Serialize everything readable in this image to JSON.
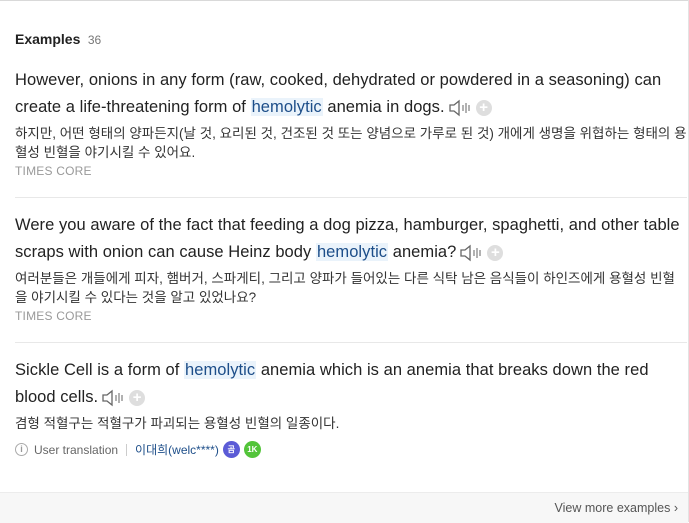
{
  "header": {
    "title": "Examples",
    "count": "36"
  },
  "examples": [
    {
      "en_before": "However, onions in any form (raw, cooked, dehydrated or powdered in a seasoning) can create a life-threatening form of ",
      "en_highlight": "hemolytic",
      "en_after": " anemia in dogs.",
      "ko": "하지만, 어떤 형태의 양파든지(날 것, 요리된 것, 건조된 것 또는 양념으로 가루로 된 것) 개에게 생명을 위협하는 형태의 용혈성 빈혈을 야기시킬 수 있어요.",
      "source": "TIMES CORE"
    },
    {
      "en_before": "Were you aware of the fact that feeding a dog pizza, hamburger, spaghetti, and other table scraps with onion can cause Heinz body ",
      "en_highlight": "hemolytic",
      "en_after": " anemia?",
      "ko": "여러분들은 개들에게 피자, 햄버거, 스파게티, 그리고 양파가 들어있는 다른 식탁 남은 음식들이 하인즈에게 용혈성 빈혈을 야기시킬 수 있다는 것을 알고 있었나요?",
      "source": "TIMES CORE"
    },
    {
      "en_before": "Sickle Cell is a form of ",
      "en_highlight": "hemolytic",
      "en_after": " anemia which is an anemia that breaks down the red blood cells.",
      "ko": "겸형 적혈구는 적혈구가 파괴되는 용혈성 빈혈의 일종이다.",
      "user_translation": "User translation",
      "user": "이대희(welc****)",
      "badges": [
        "곰",
        "1K"
      ]
    }
  ],
  "footer": {
    "more": "View more examples"
  },
  "icons": {
    "speaker": "speaker-icon",
    "add": "add-icon",
    "info": "info-icon",
    "chevron": "chevron-right-icon"
  }
}
